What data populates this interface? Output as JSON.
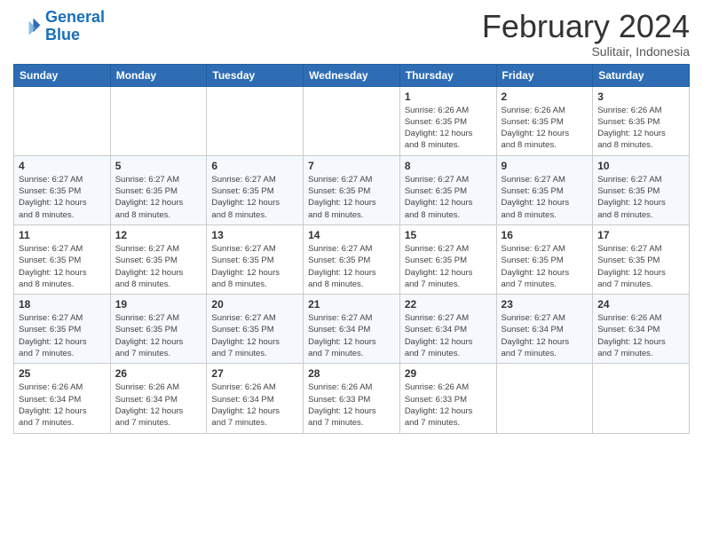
{
  "logo": {
    "line1": "General",
    "line2": "Blue"
  },
  "title": "February 2024",
  "subtitle": "Sulitair, Indonesia",
  "days_header": [
    "Sunday",
    "Monday",
    "Tuesday",
    "Wednesday",
    "Thursday",
    "Friday",
    "Saturday"
  ],
  "weeks": [
    [
      {
        "day": "",
        "info": ""
      },
      {
        "day": "",
        "info": ""
      },
      {
        "day": "",
        "info": ""
      },
      {
        "day": "",
        "info": ""
      },
      {
        "day": "1",
        "info": "Sunrise: 6:26 AM\nSunset: 6:35 PM\nDaylight: 12 hours\nand 8 minutes."
      },
      {
        "day": "2",
        "info": "Sunrise: 6:26 AM\nSunset: 6:35 PM\nDaylight: 12 hours\nand 8 minutes."
      },
      {
        "day": "3",
        "info": "Sunrise: 6:26 AM\nSunset: 6:35 PM\nDaylight: 12 hours\nand 8 minutes."
      }
    ],
    [
      {
        "day": "4",
        "info": "Sunrise: 6:27 AM\nSunset: 6:35 PM\nDaylight: 12 hours\nand 8 minutes."
      },
      {
        "day": "5",
        "info": "Sunrise: 6:27 AM\nSunset: 6:35 PM\nDaylight: 12 hours\nand 8 minutes."
      },
      {
        "day": "6",
        "info": "Sunrise: 6:27 AM\nSunset: 6:35 PM\nDaylight: 12 hours\nand 8 minutes."
      },
      {
        "day": "7",
        "info": "Sunrise: 6:27 AM\nSunset: 6:35 PM\nDaylight: 12 hours\nand 8 minutes."
      },
      {
        "day": "8",
        "info": "Sunrise: 6:27 AM\nSunset: 6:35 PM\nDaylight: 12 hours\nand 8 minutes."
      },
      {
        "day": "9",
        "info": "Sunrise: 6:27 AM\nSunset: 6:35 PM\nDaylight: 12 hours\nand 8 minutes."
      },
      {
        "day": "10",
        "info": "Sunrise: 6:27 AM\nSunset: 6:35 PM\nDaylight: 12 hours\nand 8 minutes."
      }
    ],
    [
      {
        "day": "11",
        "info": "Sunrise: 6:27 AM\nSunset: 6:35 PM\nDaylight: 12 hours\nand 8 minutes."
      },
      {
        "day": "12",
        "info": "Sunrise: 6:27 AM\nSunset: 6:35 PM\nDaylight: 12 hours\nand 8 minutes."
      },
      {
        "day": "13",
        "info": "Sunrise: 6:27 AM\nSunset: 6:35 PM\nDaylight: 12 hours\nand 8 minutes."
      },
      {
        "day": "14",
        "info": "Sunrise: 6:27 AM\nSunset: 6:35 PM\nDaylight: 12 hours\nand 8 minutes."
      },
      {
        "day": "15",
        "info": "Sunrise: 6:27 AM\nSunset: 6:35 PM\nDaylight: 12 hours\nand 7 minutes."
      },
      {
        "day": "16",
        "info": "Sunrise: 6:27 AM\nSunset: 6:35 PM\nDaylight: 12 hours\nand 7 minutes."
      },
      {
        "day": "17",
        "info": "Sunrise: 6:27 AM\nSunset: 6:35 PM\nDaylight: 12 hours\nand 7 minutes."
      }
    ],
    [
      {
        "day": "18",
        "info": "Sunrise: 6:27 AM\nSunset: 6:35 PM\nDaylight: 12 hours\nand 7 minutes."
      },
      {
        "day": "19",
        "info": "Sunrise: 6:27 AM\nSunset: 6:35 PM\nDaylight: 12 hours\nand 7 minutes."
      },
      {
        "day": "20",
        "info": "Sunrise: 6:27 AM\nSunset: 6:35 PM\nDaylight: 12 hours\nand 7 minutes."
      },
      {
        "day": "21",
        "info": "Sunrise: 6:27 AM\nSunset: 6:34 PM\nDaylight: 12 hours\nand 7 minutes."
      },
      {
        "day": "22",
        "info": "Sunrise: 6:27 AM\nSunset: 6:34 PM\nDaylight: 12 hours\nand 7 minutes."
      },
      {
        "day": "23",
        "info": "Sunrise: 6:27 AM\nSunset: 6:34 PM\nDaylight: 12 hours\nand 7 minutes."
      },
      {
        "day": "24",
        "info": "Sunrise: 6:26 AM\nSunset: 6:34 PM\nDaylight: 12 hours\nand 7 minutes."
      }
    ],
    [
      {
        "day": "25",
        "info": "Sunrise: 6:26 AM\nSunset: 6:34 PM\nDaylight: 12 hours\nand 7 minutes."
      },
      {
        "day": "26",
        "info": "Sunrise: 6:26 AM\nSunset: 6:34 PM\nDaylight: 12 hours\nand 7 minutes."
      },
      {
        "day": "27",
        "info": "Sunrise: 6:26 AM\nSunset: 6:34 PM\nDaylight: 12 hours\nand 7 minutes."
      },
      {
        "day": "28",
        "info": "Sunrise: 6:26 AM\nSunset: 6:33 PM\nDaylight: 12 hours\nand 7 minutes."
      },
      {
        "day": "29",
        "info": "Sunrise: 6:26 AM\nSunset: 6:33 PM\nDaylight: 12 hours\nand 7 minutes."
      },
      {
        "day": "",
        "info": ""
      },
      {
        "day": "",
        "info": ""
      }
    ]
  ]
}
